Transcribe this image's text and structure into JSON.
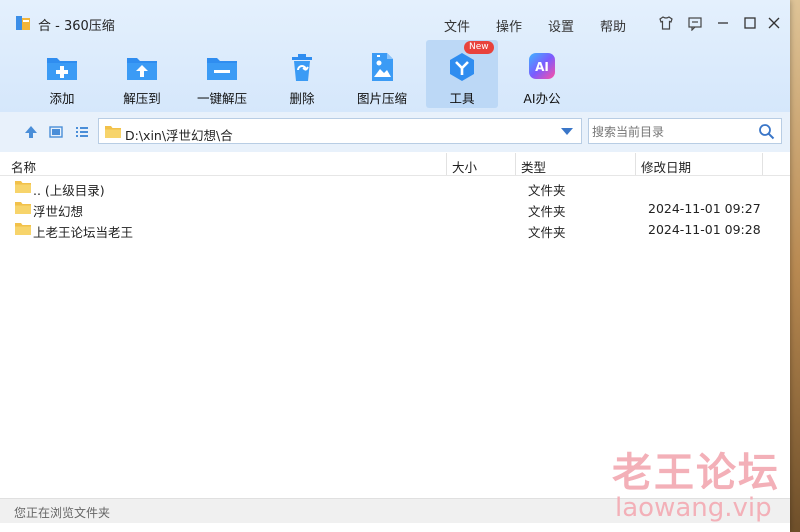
{
  "window": {
    "title": "合 - 360压缩",
    "menu": [
      "文件",
      "操作",
      "设置",
      "帮助"
    ]
  },
  "toolbar": [
    {
      "label": "添加",
      "icon": "add-icon"
    },
    {
      "label": "解压到",
      "icon": "extract-to-icon"
    },
    {
      "label": "一键解压",
      "icon": "quick-extract-icon"
    },
    {
      "label": "删除",
      "icon": "trash-icon"
    },
    {
      "label": "图片压缩",
      "icon": "image-compress-icon"
    },
    {
      "label": "工具",
      "icon": "tools-icon",
      "badge": "New",
      "active": true
    },
    {
      "label": "AI办公",
      "icon": "ai-icon",
      "icon_text": "AI"
    }
  ],
  "address": {
    "path": "D:\\xin\\浮世幻想\\合"
  },
  "search": {
    "placeholder": "搜索当前目录"
  },
  "columns": {
    "name": "名称",
    "size": "大小",
    "type": "类型",
    "modified": "修改日期"
  },
  "files": [
    {
      "name": ".. (上级目录)",
      "size": "",
      "type": "文件夹",
      "modified": ""
    },
    {
      "name": "浮世幻想",
      "size": "",
      "type": "文件夹",
      "modified": "2024-11-01 09:27"
    },
    {
      "name": "上老王论坛当老王",
      "size": "",
      "type": "文件夹",
      "modified": "2024-11-01 09:28"
    }
  ],
  "status": "您正在浏览文件夹",
  "watermark": {
    "title": "老王论坛",
    "url": "laowang.vip"
  },
  "colors": {
    "accent": "#2f8df0",
    "toolbar_bg": "#d5e7fb",
    "badge": "#e8423c"
  }
}
